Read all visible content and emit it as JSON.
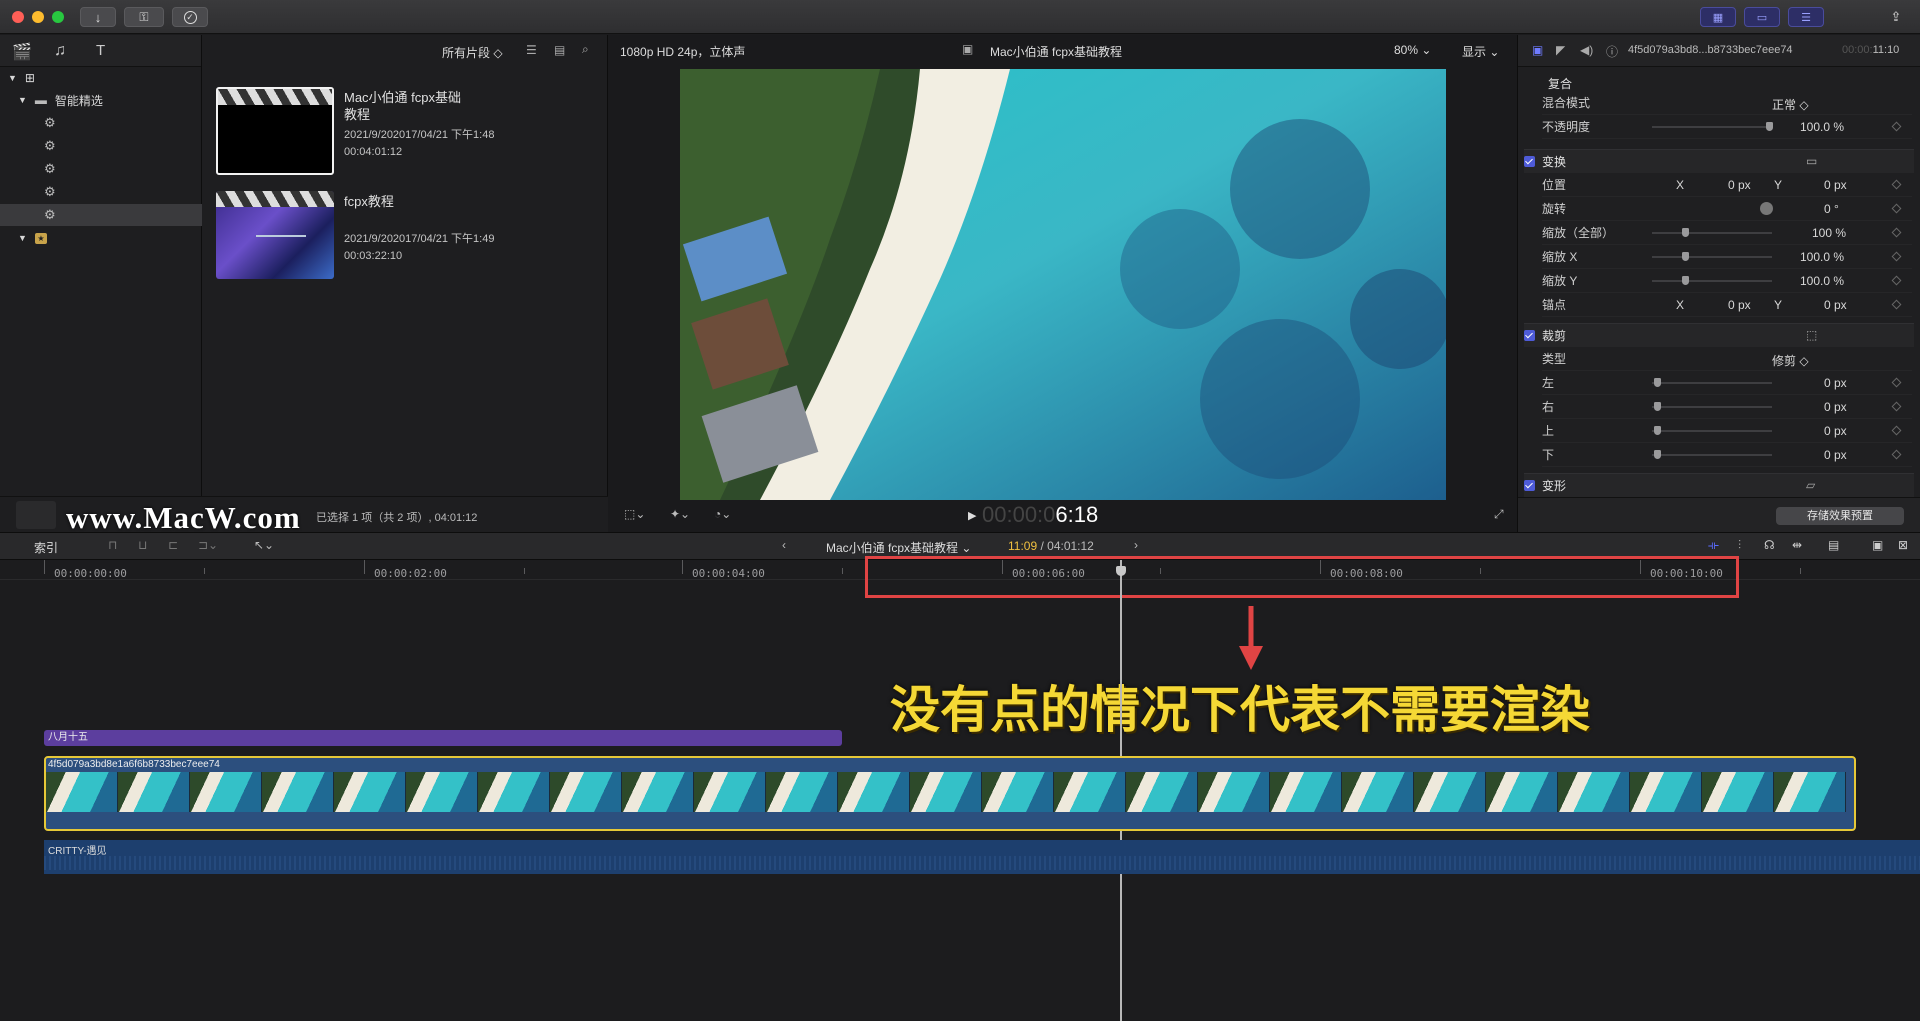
{
  "toolbar": {
    "buttons": [
      "download-icon",
      "key-icon",
      "checkmark-icon"
    ],
    "right_buttons": [
      "browser-layout-icon",
      "timeline-layout-icon",
      "inspector-layout-icon",
      "share-icon"
    ]
  },
  "library": {
    "smart_collections_label": "智能精选",
    "items_count": 5
  },
  "browser": {
    "filter_label": "所有片段 ◇",
    "clips": [
      {
        "title_line1": "Mac小伯通 fcpx基础",
        "title_line2": "教程",
        "date": "2021/9/202017/04/21 下午1:48",
        "duration": "00:04:01:12"
      },
      {
        "title_line1": "fcpx教程",
        "title_line2": "",
        "date": "2021/9/202017/04/21 下午1:49",
        "duration": "00:03:22:10"
      }
    ],
    "status": "已选择 1 项（共 2 项）, 04:01:12",
    "watermark": "www.MacW.com"
  },
  "viewer": {
    "format": "1080p HD 24p，立体声",
    "project_title": "Mac小伯通 fcpx基础教程",
    "zoom": "80%",
    "display_label": "显示",
    "timecode_dim": "00:00:0",
    "timecode_bright": "6:18"
  },
  "inspector": {
    "clip_id": "4f5d079a3bd8...b8733bec7eee74",
    "duration_dim": "00:00:",
    "duration": "11:10",
    "composite_header": "复合",
    "blend_mode_label": "混合模式",
    "blend_mode_value": "正常 ◇",
    "opacity_label": "不透明度",
    "opacity_value": "100.0 %",
    "transform_header": "变换",
    "position_label": "位置",
    "rotation_label": "旋转",
    "rotation_value": "0 °",
    "scale_all_label": "缩放（全部）",
    "scale_all_value": "100 %",
    "scale_x_label": "缩放 X",
    "scale_x_value": "100.0 %",
    "scale_y_label": "缩放 Y",
    "scale_y_value": "100.0 %",
    "anchor_label": "锚点",
    "x_label": "X",
    "y_label": "Y",
    "zero_px": "0 px",
    "crop_header": "裁剪",
    "type_label": "类型",
    "type_value": "修剪 ◇",
    "left_label": "左",
    "right_label": "右",
    "top_label": "上",
    "bottom_label": "下",
    "distort_header": "变形",
    "save_preset": "存储效果预置"
  },
  "midbar": {
    "index_label": "索引",
    "project_name": "Mac小伯通 fcpx基础教程",
    "current_tc": "11:09",
    "total_tc": " / 04:01:12"
  },
  "timeline": {
    "ruler_labels": [
      "00:00:00:00",
      "00:00:02:00",
      "00:00:04:00",
      "00:00:06:00",
      "00:00:08:00",
      "00:00:10:00"
    ],
    "title_clip": "八月十五",
    "video_clip": "4f5d079a3bd8e1a6f6b8733bec7eee74",
    "audio_clip": "CRITTY-遇见",
    "annotation": "没有点的情况下代表不需要渲染",
    "colors": {
      "highlight_box": "#e04444",
      "annotation_text": "#f5d835",
      "title_clip": "#5c3e9e",
      "video_border": "#e6c838",
      "audio_clip": "#1d3f6e"
    }
  }
}
